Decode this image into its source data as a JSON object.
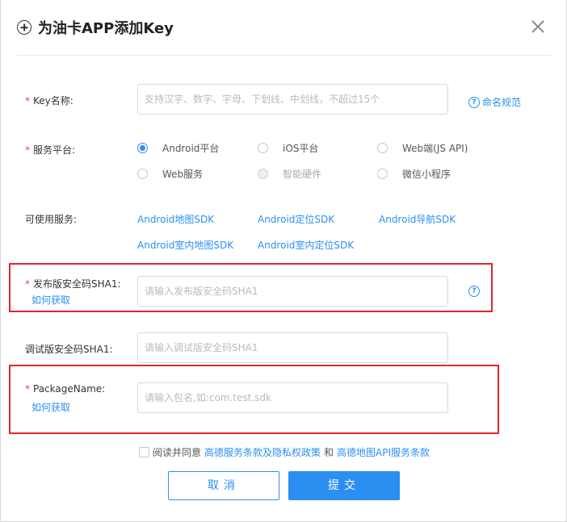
{
  "dialog": {
    "title": "为油卡APP添加Key"
  },
  "key_name": {
    "label": "Key名称:",
    "placeholder": "支持汉字、数字、字母、下划线、中划线，不超过15个",
    "help": "命名规范"
  },
  "platform": {
    "label": "服务平台:",
    "options": [
      {
        "label": "Android平台",
        "checked": true,
        "disabled": false
      },
      {
        "label": "iOS平台",
        "checked": false,
        "disabled": false
      },
      {
        "label": "Web端(JS API)",
        "checked": false,
        "disabled": false
      },
      {
        "label": "Web服务",
        "checked": false,
        "disabled": false
      },
      {
        "label": "智能硬件",
        "checked": false,
        "disabled": true
      },
      {
        "label": "微信小程序",
        "checked": false,
        "disabled": false
      }
    ]
  },
  "services": {
    "label": "可使用服务:",
    "items": [
      "Android地图SDK",
      "Android定位SDK",
      "Android导航SDK",
      "Android室内地图SDK",
      "Android室内定位SDK"
    ]
  },
  "release_sha1": {
    "label": "发布版安全码SHA1:",
    "how_to": "如何获取",
    "placeholder": "请输入发布版安全码SHA1"
  },
  "debug_sha1": {
    "label": "调试版安全码SHA1:",
    "placeholder": "请输入调试版安全码SHA1"
  },
  "package_name": {
    "label": "PackageName:",
    "how_to": "如何获取",
    "placeholder": "请输入包名,如:com.test.sdk"
  },
  "agreement": {
    "prefix": "阅读并同意",
    "link1": "高德服务条款及隐私权政策",
    "and": "和",
    "link2": "高德地图API服务条款"
  },
  "buttons": {
    "cancel": "取消",
    "submit": "提交"
  },
  "colors": {
    "accent": "#2b8ff2",
    "required": "#e64340",
    "highlight_box": "#e0262b"
  }
}
